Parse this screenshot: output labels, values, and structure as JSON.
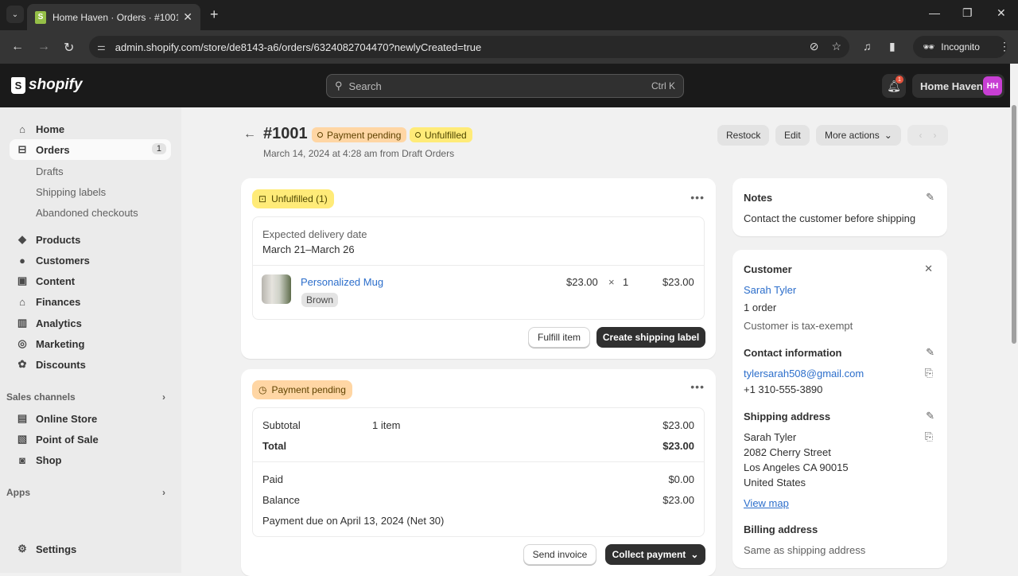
{
  "browser": {
    "tab_title": "Home Haven · Orders · #1001 ·",
    "url": "admin.shopify.com/store/de8143-a6/orders/6324082704470?newlyCreated=true",
    "incognito_label": "Incognito"
  },
  "topbar": {
    "brand": "shopify",
    "search_placeholder": "Search",
    "search_shortcut": "Ctrl K",
    "notification_count": "1",
    "store_name": "Home Haven",
    "store_initials": "HH"
  },
  "sidebar": {
    "items": [
      {
        "label": "Home",
        "icon": "home-icon"
      },
      {
        "label": "Orders",
        "icon": "orders-icon",
        "count": "1"
      },
      {
        "label": "Products",
        "icon": "tag-icon"
      },
      {
        "label": "Customers",
        "icon": "person-icon"
      },
      {
        "label": "Content",
        "icon": "image-icon"
      },
      {
        "label": "Finances",
        "icon": "bank-icon"
      },
      {
        "label": "Analytics",
        "icon": "bar-chart-icon"
      },
      {
        "label": "Marketing",
        "icon": "target-icon"
      },
      {
        "label": "Discounts",
        "icon": "discount-icon"
      }
    ],
    "order_subitems": [
      "Drafts",
      "Shipping labels",
      "Abandoned checkouts"
    ],
    "sales_channels_label": "Sales channels",
    "channels": [
      "Online Store",
      "Point of Sale",
      "Shop"
    ],
    "apps_label": "Apps",
    "settings_label": "Settings"
  },
  "order": {
    "number": "#1001",
    "payment_status": "Payment pending",
    "fulfillment_status": "Unfulfilled",
    "subtitle": "March 14, 2024 at 4:28 am from Draft Orders",
    "actions": {
      "restock": "Restock",
      "edit": "Edit",
      "more": "More actions"
    }
  },
  "fulfillment": {
    "badge": "Unfulfilled (1)",
    "delivery_label": "Expected delivery date",
    "delivery_value": "March 21–March 26",
    "item": {
      "name": "Personalized Mug",
      "variant": "Brown",
      "price": "$23.00",
      "times": "×",
      "qty": "1",
      "total": "$23.00"
    },
    "fulfill_button": "Fulfill item",
    "label_button": "Create shipping label"
  },
  "payment": {
    "badge": "Payment pending",
    "subtotal_label": "Subtotal",
    "subtotal_items": "1 item",
    "subtotal_value": "$23.00",
    "total_label": "Total",
    "total_value": "$23.00",
    "paid_label": "Paid",
    "paid_value": "$0.00",
    "balance_label": "Balance",
    "balance_value": "$23.00",
    "due_text": "Payment due on April 13, 2024 (Net 30)",
    "send_invoice": "Send invoice",
    "collect_payment": "Collect payment"
  },
  "notes": {
    "title": "Notes",
    "text": "Contact the customer before shipping"
  },
  "customer": {
    "title": "Customer",
    "name": "Sarah Tyler",
    "orders": "1 order",
    "tax": "Customer is tax-exempt",
    "contact_title": "Contact information",
    "email": "tylersarah508@gmail.com",
    "phone": "+1 310-555-3890",
    "shipping_title": "Shipping address",
    "address": [
      "Sarah Tyler",
      "2082 Cherry Street",
      "Los Angeles CA 90015",
      "United States"
    ],
    "view_map": "View map",
    "billing_title": "Billing address",
    "billing_text": "Same as shipping address"
  }
}
